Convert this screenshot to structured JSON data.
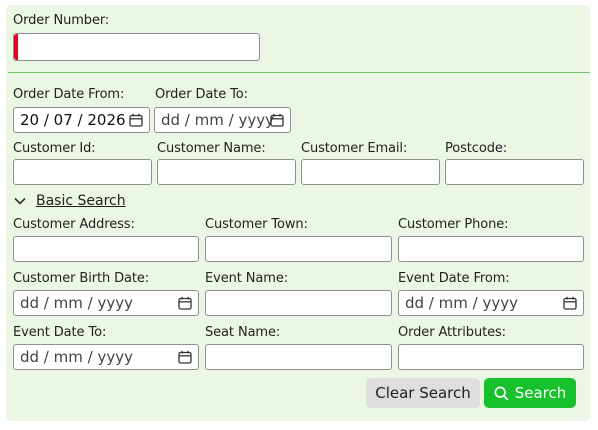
{
  "order_number": {
    "label": "Order Number:",
    "value": ""
  },
  "order_date_from": {
    "label": "Order Date From:",
    "value": "20 / 07 / 2026"
  },
  "order_date_to": {
    "label": "Order Date To:",
    "placeholder": "dd / mm / yyyy"
  },
  "customer_id": {
    "label": "Customer Id:",
    "value": ""
  },
  "customer_name": {
    "label": "Customer Name:",
    "value": ""
  },
  "customer_email": {
    "label": "Customer Email:",
    "value": ""
  },
  "postcode": {
    "label": "Postcode:",
    "value": ""
  },
  "basic_search": {
    "label": "Basic Search",
    "icon": "chevron-down-icon"
  },
  "customer_address": {
    "label": "Customer Address:",
    "value": ""
  },
  "customer_town": {
    "label": "Customer Town:",
    "value": ""
  },
  "customer_phone": {
    "label": "Customer Phone:",
    "value": ""
  },
  "customer_birth_date": {
    "label": "Customer Birth Date:",
    "placeholder": "dd / mm / yyyy"
  },
  "event_name": {
    "label": "Event Name:",
    "value": ""
  },
  "event_date_from": {
    "label": "Event Date From:",
    "placeholder": "dd / mm / yyyy"
  },
  "event_date_to": {
    "label": "Event Date To:",
    "placeholder": "dd / mm / yyyy"
  },
  "seat_name": {
    "label": "Seat Name:",
    "value": ""
  },
  "order_attributes": {
    "label": "Order Attributes:",
    "value": ""
  },
  "buttons": {
    "clear": "Clear Search",
    "search": "Search"
  },
  "colors": {
    "panel_bg": "#ebf7e4",
    "divider": "#79c06a",
    "required_marker": "#e3001b",
    "search_button": "#17c12c",
    "clear_button": "#dedede"
  }
}
